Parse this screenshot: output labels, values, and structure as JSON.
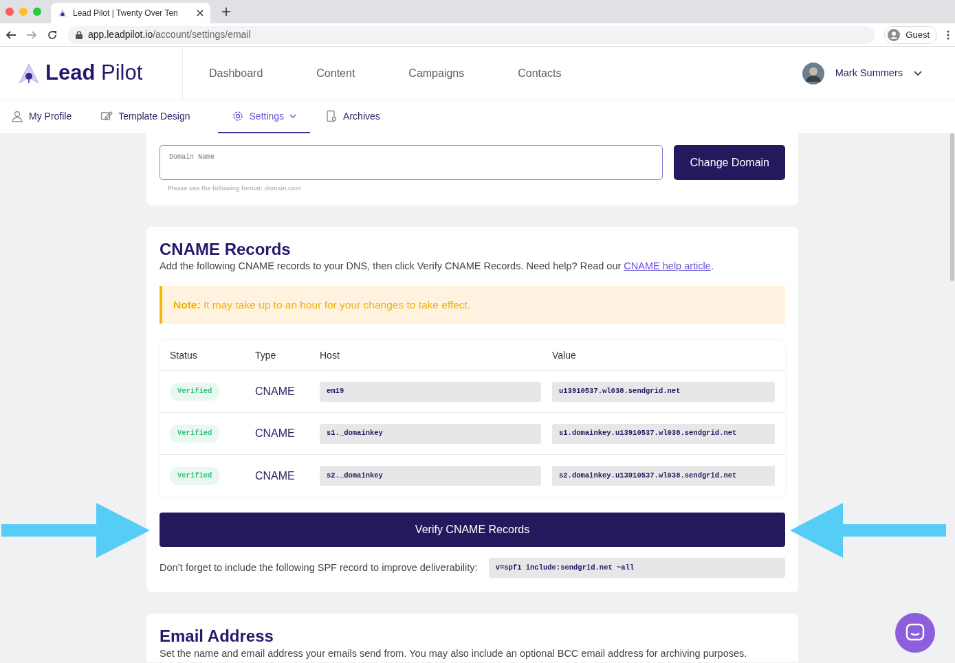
{
  "browser": {
    "tab_title": "Lead Pilot | Twenty Over Ten",
    "url_host": "app.leadpilot.io",
    "url_path": "/account/settings/email",
    "profile": "Guest"
  },
  "header": {
    "logo": "**Lead** Pilot",
    "nav": [
      "Dashboard",
      "Content",
      "Campaigns",
      "Contacts"
    ],
    "user": "Mark Summers"
  },
  "subnav": [
    {
      "label": "My Profile",
      "selected": false
    },
    {
      "label": "Template Design",
      "selected": false
    },
    {
      "label": "Settings",
      "selected": true
    },
    {
      "label": "Archives",
      "selected": false
    }
  ],
  "domain": {
    "label": "Domain Name",
    "hint": "Please use the following format: domain.com",
    "button": "Change Domain"
  },
  "cname": {
    "title": "CNAME Records",
    "intro": "Add the following CNAME records to your DNS, then click Verify CNAME Records. Need help? Read our ",
    "link": "CNAME help article",
    "intro_end": ".",
    "note": "**Note:** It may take up to an hour for your changes to take effect.",
    "columns": [
      "Status",
      "Type",
      "Host",
      "Value"
    ],
    "rows": [
      {
        "status": "Verified",
        "type": "CNAME",
        "host": "em19",
        "value": "u13910537.wl038.sendgrid.net"
      },
      {
        "status": "Verified",
        "type": "CNAME",
        "host": "s1._domainkey",
        "value": "s1.domainkey.u13910537.wl038.sendgrid.net"
      },
      {
        "status": "Verified",
        "type": "CNAME",
        "host": "s2._domainkey",
        "value": "s2.domainkey.u13910537.wl038.sendgrid.net"
      }
    ],
    "verify_button": "Verify CNAME Records",
    "spf_text": "Don’t forget to include the following SPF record to improve deliverability:",
    "spf_value": "v=spf1 include:sendgrid.net ~all"
  },
  "email": {
    "title": "Email Address",
    "description": "Set the name and email address your emails send from. You may also include an optional BCC email address for archiving purposes."
  }
}
